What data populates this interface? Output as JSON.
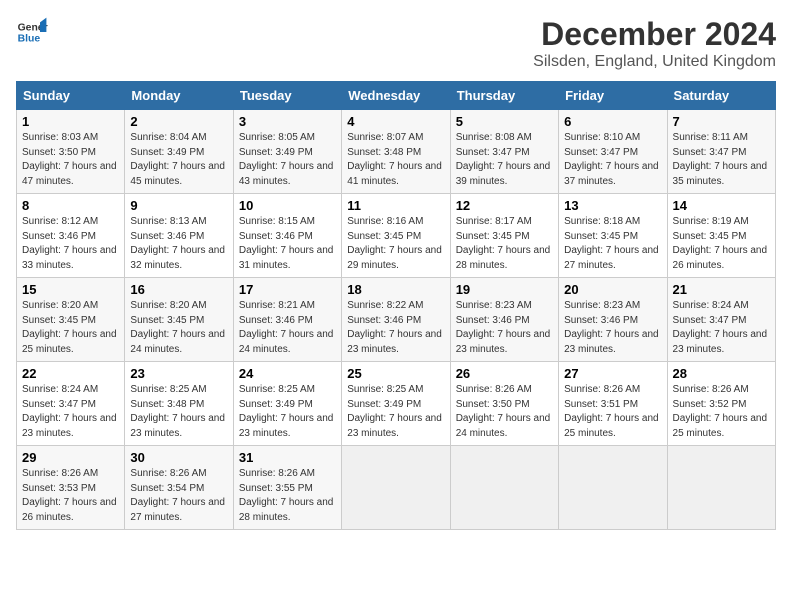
{
  "logo": {
    "line1": "General",
    "line2": "Blue"
  },
  "title": "December 2024",
  "subtitle": "Silsden, England, United Kingdom",
  "days_of_week": [
    "Sunday",
    "Monday",
    "Tuesday",
    "Wednesday",
    "Thursday",
    "Friday",
    "Saturday"
  ],
  "weeks": [
    [
      {
        "day": "1",
        "sunrise": "Sunrise: 8:03 AM",
        "sunset": "Sunset: 3:50 PM",
        "daylight": "Daylight: 7 hours and 47 minutes."
      },
      {
        "day": "2",
        "sunrise": "Sunrise: 8:04 AM",
        "sunset": "Sunset: 3:49 PM",
        "daylight": "Daylight: 7 hours and 45 minutes."
      },
      {
        "day": "3",
        "sunrise": "Sunrise: 8:05 AM",
        "sunset": "Sunset: 3:49 PM",
        "daylight": "Daylight: 7 hours and 43 minutes."
      },
      {
        "day": "4",
        "sunrise": "Sunrise: 8:07 AM",
        "sunset": "Sunset: 3:48 PM",
        "daylight": "Daylight: 7 hours and 41 minutes."
      },
      {
        "day": "5",
        "sunrise": "Sunrise: 8:08 AM",
        "sunset": "Sunset: 3:47 PM",
        "daylight": "Daylight: 7 hours and 39 minutes."
      },
      {
        "day": "6",
        "sunrise": "Sunrise: 8:10 AM",
        "sunset": "Sunset: 3:47 PM",
        "daylight": "Daylight: 7 hours and 37 minutes."
      },
      {
        "day": "7",
        "sunrise": "Sunrise: 8:11 AM",
        "sunset": "Sunset: 3:47 PM",
        "daylight": "Daylight: 7 hours and 35 minutes."
      }
    ],
    [
      {
        "day": "8",
        "sunrise": "Sunrise: 8:12 AM",
        "sunset": "Sunset: 3:46 PM",
        "daylight": "Daylight: 7 hours and 33 minutes."
      },
      {
        "day": "9",
        "sunrise": "Sunrise: 8:13 AM",
        "sunset": "Sunset: 3:46 PM",
        "daylight": "Daylight: 7 hours and 32 minutes."
      },
      {
        "day": "10",
        "sunrise": "Sunrise: 8:15 AM",
        "sunset": "Sunset: 3:46 PM",
        "daylight": "Daylight: 7 hours and 31 minutes."
      },
      {
        "day": "11",
        "sunrise": "Sunrise: 8:16 AM",
        "sunset": "Sunset: 3:45 PM",
        "daylight": "Daylight: 7 hours and 29 minutes."
      },
      {
        "day": "12",
        "sunrise": "Sunrise: 8:17 AM",
        "sunset": "Sunset: 3:45 PM",
        "daylight": "Daylight: 7 hours and 28 minutes."
      },
      {
        "day": "13",
        "sunrise": "Sunrise: 8:18 AM",
        "sunset": "Sunset: 3:45 PM",
        "daylight": "Daylight: 7 hours and 27 minutes."
      },
      {
        "day": "14",
        "sunrise": "Sunrise: 8:19 AM",
        "sunset": "Sunset: 3:45 PM",
        "daylight": "Daylight: 7 hours and 26 minutes."
      }
    ],
    [
      {
        "day": "15",
        "sunrise": "Sunrise: 8:20 AM",
        "sunset": "Sunset: 3:45 PM",
        "daylight": "Daylight: 7 hours and 25 minutes."
      },
      {
        "day": "16",
        "sunrise": "Sunrise: 8:20 AM",
        "sunset": "Sunset: 3:45 PM",
        "daylight": "Daylight: 7 hours and 24 minutes."
      },
      {
        "day": "17",
        "sunrise": "Sunrise: 8:21 AM",
        "sunset": "Sunset: 3:46 PM",
        "daylight": "Daylight: 7 hours and 24 minutes."
      },
      {
        "day": "18",
        "sunrise": "Sunrise: 8:22 AM",
        "sunset": "Sunset: 3:46 PM",
        "daylight": "Daylight: 7 hours and 23 minutes."
      },
      {
        "day": "19",
        "sunrise": "Sunrise: 8:23 AM",
        "sunset": "Sunset: 3:46 PM",
        "daylight": "Daylight: 7 hours and 23 minutes."
      },
      {
        "day": "20",
        "sunrise": "Sunrise: 8:23 AM",
        "sunset": "Sunset: 3:46 PM",
        "daylight": "Daylight: 7 hours and 23 minutes."
      },
      {
        "day": "21",
        "sunrise": "Sunrise: 8:24 AM",
        "sunset": "Sunset: 3:47 PM",
        "daylight": "Daylight: 7 hours and 23 minutes."
      }
    ],
    [
      {
        "day": "22",
        "sunrise": "Sunrise: 8:24 AM",
        "sunset": "Sunset: 3:47 PM",
        "daylight": "Daylight: 7 hours and 23 minutes."
      },
      {
        "day": "23",
        "sunrise": "Sunrise: 8:25 AM",
        "sunset": "Sunset: 3:48 PM",
        "daylight": "Daylight: 7 hours and 23 minutes."
      },
      {
        "day": "24",
        "sunrise": "Sunrise: 8:25 AM",
        "sunset": "Sunset: 3:49 PM",
        "daylight": "Daylight: 7 hours and 23 minutes."
      },
      {
        "day": "25",
        "sunrise": "Sunrise: 8:25 AM",
        "sunset": "Sunset: 3:49 PM",
        "daylight": "Daylight: 7 hours and 23 minutes."
      },
      {
        "day": "26",
        "sunrise": "Sunrise: 8:26 AM",
        "sunset": "Sunset: 3:50 PM",
        "daylight": "Daylight: 7 hours and 24 minutes."
      },
      {
        "day": "27",
        "sunrise": "Sunrise: 8:26 AM",
        "sunset": "Sunset: 3:51 PM",
        "daylight": "Daylight: 7 hours and 25 minutes."
      },
      {
        "day": "28",
        "sunrise": "Sunrise: 8:26 AM",
        "sunset": "Sunset: 3:52 PM",
        "daylight": "Daylight: 7 hours and 25 minutes."
      }
    ],
    [
      {
        "day": "29",
        "sunrise": "Sunrise: 8:26 AM",
        "sunset": "Sunset: 3:53 PM",
        "daylight": "Daylight: 7 hours and 26 minutes."
      },
      {
        "day": "30",
        "sunrise": "Sunrise: 8:26 AM",
        "sunset": "Sunset: 3:54 PM",
        "daylight": "Daylight: 7 hours and 27 minutes."
      },
      {
        "day": "31",
        "sunrise": "Sunrise: 8:26 AM",
        "sunset": "Sunset: 3:55 PM",
        "daylight": "Daylight: 7 hours and 28 minutes."
      },
      null,
      null,
      null,
      null
    ]
  ]
}
